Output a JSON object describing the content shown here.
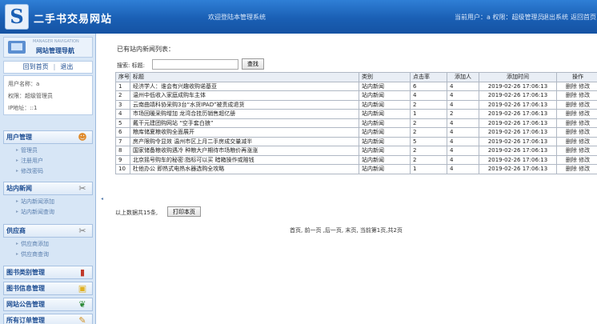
{
  "header": {
    "logo_glyph": "S",
    "site_title": "二手书交易网站",
    "welcome": "欢迎登陆本管理系统",
    "current_user": "当前用户：a 权限：超级管理员",
    "logout": "退出系统",
    "home": "返回首页"
  },
  "sidebar": {
    "nav_subtitle": "MANAGER NAVIGATION",
    "nav_title": "网站管理导航",
    "home_link": "回到首页",
    "logout_link": "退出",
    "user_name": "用户名称：a",
    "user_role": "权限：超级管理员",
    "user_ip": "IP地址：::1",
    "menus": [
      {
        "label": "用户管理",
        "icon": "users-icon",
        "items": [
          "管理员",
          "注册用户",
          "修改密码"
        ]
      },
      {
        "label": "站内新闻",
        "icon": "tools-icon",
        "items": [
          "站内新闻添加",
          "站内新闻查询"
        ]
      },
      {
        "label": "供应商",
        "icon": "tools-icon",
        "items": [
          "供应商添加",
          "供应商查询"
        ]
      },
      {
        "label": "图书类别管理",
        "icon": "books-icon",
        "items": []
      },
      {
        "label": "图书信息管理",
        "icon": "lock-icon",
        "items": []
      },
      {
        "label": "网站公告管理",
        "icon": "leaf-icon",
        "items": []
      },
      {
        "label": "所有订单管理",
        "icon": "pen-icon",
        "items": []
      }
    ]
  },
  "main": {
    "list_title": "已有站内新闻列表：",
    "search_label": "搜索: 标题:",
    "search_value": "",
    "search_button": "查找",
    "columns": [
      "序号",
      "标题",
      "类别",
      "点击率",
      "添加人",
      "添加时间",
      "操作"
    ],
    "rows": [
      {
        "no": "1",
        "title": "经济学人：谁会有兴趣收购诺基亚",
        "cat": "站内新闻",
        "clicks": "6",
        "adder": "4",
        "time": "2019-02-26 17:06:13"
      },
      {
        "no": "2",
        "title": "温州中低收入家庭成购车主体",
        "cat": "站内新闻",
        "clicks": "4",
        "adder": "4",
        "time": "2019-02-26 17:06:13"
      },
      {
        "no": "3",
        "title": "云南曲靖科协采购3台“水货IPAD”被责成退货",
        "cat": "站内新闻",
        "clicks": "2",
        "adder": "4",
        "time": "2019-02-26 17:06:13"
      },
      {
        "no": "4",
        "title": "市场回暖采购增加 龙湾合挂历销售超亿册",
        "cat": "站内新闻",
        "clicks": "1",
        "adder": "2",
        "time": "2019-02-26 17:06:13"
      },
      {
        "no": "5",
        "title": "戴干元建团购网站 “空手套白狼”",
        "cat": "站内新闻",
        "clicks": "2",
        "adder": "4",
        "time": "2019-02-26 17:06:13"
      },
      {
        "no": "6",
        "title": "粮库储夏粮收购全面展开",
        "cat": "站内新闻",
        "clicks": "2",
        "adder": "4",
        "time": "2019-02-26 17:06:13"
      },
      {
        "no": "7",
        "title": "房产限购令显效 温州市区上月二手房成交量减半",
        "cat": "站内新闻",
        "clicks": "5",
        "adder": "4",
        "time": "2019-02-26 17:06:13"
      },
      {
        "no": "8",
        "title": "国家储备粮收购遇冷 种粮大户期待市场粮价再涨涨",
        "cat": "站内新闻",
        "clicks": "2",
        "adder": "4",
        "time": "2019-02-26 17:06:13"
      },
      {
        "no": "9",
        "title": "北京摇号购车的秘密:指标可以买 暗箱操作或赔钱",
        "cat": "站内新闻",
        "clicks": "2",
        "adder": "4",
        "time": "2019-02-26 17:06:13"
      },
      {
        "no": "10",
        "title": "杜他办公 即热式电热水器选购全攻略",
        "cat": "站内新闻",
        "clicks": "1",
        "adder": "4",
        "time": "2019-02-26 17:06:13"
      }
    ],
    "op_delete": "删除",
    "op_edit": "修改",
    "summary": "以上数据共15条,",
    "print_button": "打印本页",
    "pagination": "首页, 前一页 ,后一页, 末页, 当前第1页,共2页"
  }
}
